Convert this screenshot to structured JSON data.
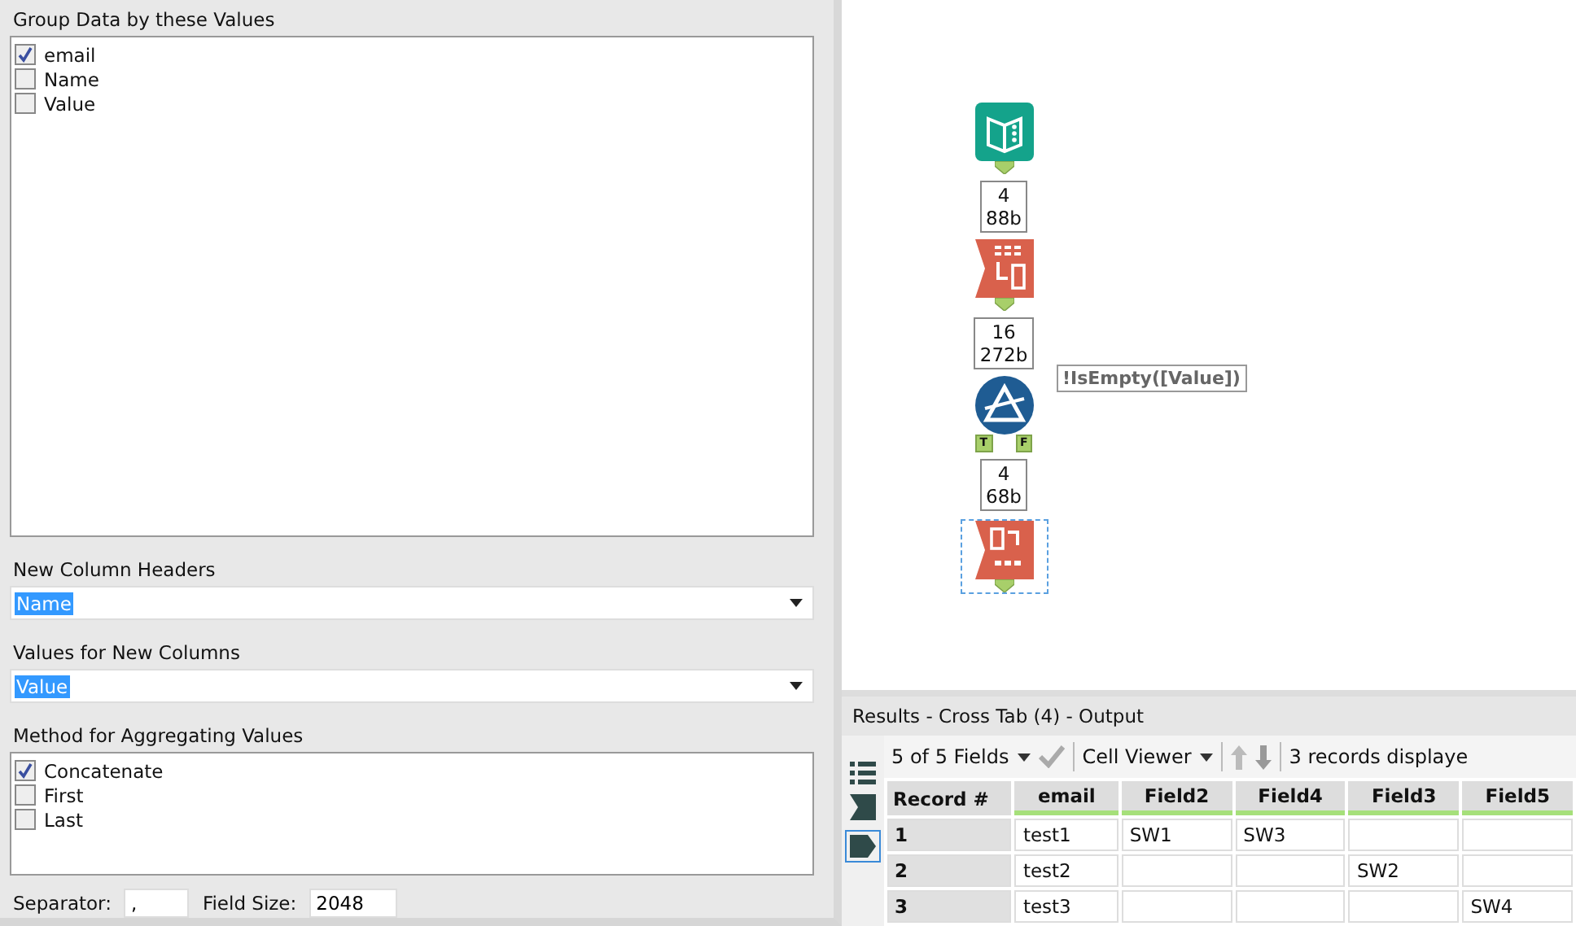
{
  "group_by": {
    "label": "Group Data by these Values",
    "items": [
      {
        "label": "email",
        "checked": true
      },
      {
        "label": "Name",
        "checked": false
      },
      {
        "label": "Value",
        "checked": false
      }
    ]
  },
  "column_headers": {
    "label": "New Column Headers",
    "value": "Name"
  },
  "values_for_columns": {
    "label": "Values for New Columns",
    "value": "Value"
  },
  "method": {
    "label": "Method for Aggregating Values",
    "items": [
      {
        "label": "Concatenate",
        "checked": true
      },
      {
        "label": "First",
        "checked": false
      },
      {
        "label": "Last",
        "checked": false
      }
    ]
  },
  "separator": {
    "label": "Separator:",
    "value": ","
  },
  "field_size": {
    "label": "Field Size:",
    "value": "2048"
  },
  "workflow": [
    {
      "kind": "input",
      "selected": false
    },
    {
      "kind": "count",
      "records": "4",
      "size": "88b"
    },
    {
      "kind": "transpose",
      "selected": false
    },
    {
      "kind": "count",
      "records": "16",
      "size": "272b"
    },
    {
      "kind": "filter",
      "selected": false,
      "annotation": "!IsEmpty([Value])",
      "true_anchor": "T",
      "false_anchor": "F"
    },
    {
      "kind": "count",
      "records": "4",
      "size": "68b"
    },
    {
      "kind": "crosstab",
      "selected": true
    }
  ],
  "results": {
    "title": "Results - Cross Tab (4) - Output",
    "fields": "5 of 5 Fields",
    "viewer": "Cell Viewer",
    "records": "3 records displaye",
    "columns": [
      "Record #",
      "email",
      "Field2",
      "Field4",
      "Field3",
      "Field5"
    ],
    "rows": [
      {
        "cells": [
          "1",
          "test1",
          "SW1",
          "SW3",
          "",
          ""
        ]
      },
      {
        "cells": [
          "2",
          "test2",
          "",
          "",
          "SW2",
          ""
        ]
      },
      {
        "cells": [
          "3",
          "test3",
          "",
          "",
          "",
          "SW4"
        ]
      }
    ]
  }
}
